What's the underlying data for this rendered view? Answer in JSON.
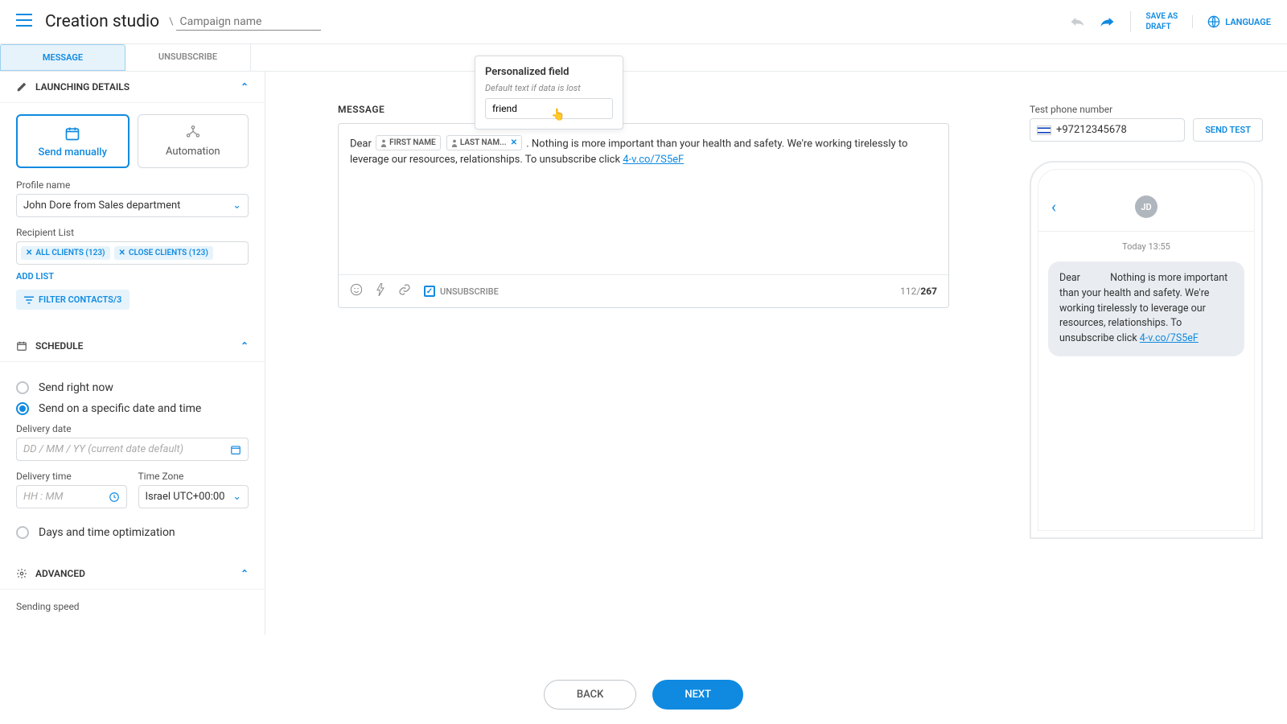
{
  "header": {
    "title": "Creation studio",
    "campaign_placeholder": "Campaign name",
    "save_draft": "SAVE AS\nDRAFT",
    "language": "LANGUAGE"
  },
  "subtabs": {
    "message": "MESSAGE",
    "unsubscribe": "UNSUBSCRIBE"
  },
  "sidebar": {
    "launching": {
      "title": "LAUNCHING DETAILS",
      "send_manually": "Send manually",
      "automation": "Automation",
      "profile_label": "Profile name",
      "profile_value": "John Dore from Sales department",
      "recipient_label": "Recipient List",
      "chip1": "ALL CLIENTS (123)",
      "chip2": "CLOSE CLIENTS (123)",
      "add_list": "ADD LIST",
      "filter": "FILTER CONTACTS/3"
    },
    "schedule": {
      "title": "SCHEDULE",
      "opt_now": "Send right now",
      "opt_date": "Send on a specific date and time",
      "delivery_date_label": "Delivery date",
      "delivery_date_ph": "DD / MM / YY (current date default)",
      "delivery_time_label": "Delivery time",
      "delivery_time_ph": "HH : MM",
      "tz_label": "Time Zone",
      "tz_value": "Israel UTC+00:00",
      "opt_optimize": "Days and time optimization"
    },
    "advanced": {
      "title": "ADVANCED",
      "speed_label": "Sending speed"
    }
  },
  "editor": {
    "header": "MESSAGE",
    "prefix": "Dear ",
    "token1": "FIRST NAME",
    "token2": "LAST NAM...",
    "body_mid": ". Nothing is more important than your health and safety. We're working tirelessly to leverage our resources, relationships. To unsubscribe click ",
    "unsub_url": "4-v.co/7S5eF",
    "unsub_label": "UNSUBSCRIBE",
    "count_used": "112",
    "count_sep": "/",
    "count_total": "267"
  },
  "popover": {
    "title": "Personalized field",
    "subtitle": "Default text if data is lost",
    "value": "friend"
  },
  "preview": {
    "test_label": "Test phone number",
    "phone_value": "+97212345678",
    "send_test": "SEND TEST",
    "avatar": "JD",
    "timestamp": "Today 13:55",
    "bubble_pre": "Dear            Nothing is more important than your health and safety. We're working tirelessly to leverage our resources, relationships. To unsubscribe click ",
    "bubble_link": "4-v.co/7S5eF"
  },
  "footer": {
    "back": "BACK",
    "next": "NEXT"
  }
}
